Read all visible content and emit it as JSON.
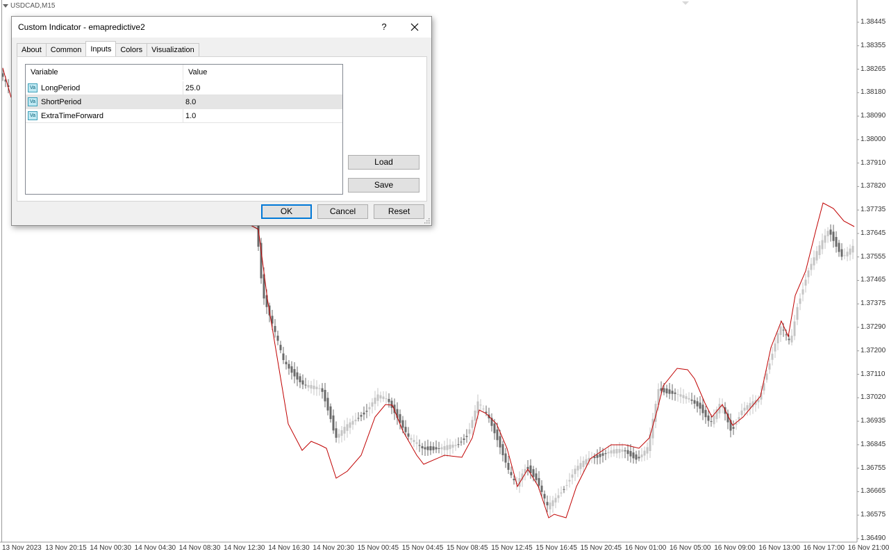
{
  "chart": {
    "symbol": "USDCAD,M15",
    "price_axis": [
      "1.38445",
      "1.38355",
      "1.38265",
      "1.38180",
      "1.38090",
      "1.38000",
      "1.37910",
      "1.37820",
      "1.37735",
      "1.37645",
      "1.37555",
      "1.37465",
      "1.37375",
      "1.37290",
      "1.37200",
      "1.37110",
      "1.37020",
      "1.36935",
      "1.36845",
      "1.36755",
      "1.36665",
      "1.36575",
      "1.36490"
    ],
    "time_axis": [
      "13 Nov 2023",
      "13 Nov 20:15",
      "14 Nov 00:30",
      "14 Nov 04:30",
      "14 Nov 08:30",
      "14 Nov 12:30",
      "14 Nov 16:30",
      "14 Nov 20:30",
      "15 Nov 00:45",
      "15 Nov 04:45",
      "15 Nov 08:45",
      "15 Nov 12:45",
      "15 Nov 16:45",
      "15 Nov 20:45",
      "16 Nov 01:00",
      "16 Nov 05:00",
      "16 Nov 09:00",
      "16 Nov 13:00",
      "16 Nov 17:00",
      "16 Nov 21:00"
    ],
    "colors": {
      "candle_up": "#c4c4c4",
      "candle_down": "#6a6a6a",
      "indicator_line": "#c00000"
    }
  },
  "dialog": {
    "title": "Custom Indicator - emapredictive2",
    "help_glyph": "?",
    "tabs": [
      {
        "label": "About"
      },
      {
        "label": "Common"
      },
      {
        "label": "Inputs"
      },
      {
        "label": "Colors"
      },
      {
        "label": "Visualization"
      }
    ],
    "active_tab": "Inputs",
    "grid": {
      "headers": {
        "variable": "Variable",
        "value": "Value"
      },
      "icon_text": "Va",
      "rows": [
        {
          "variable": "LongPeriod",
          "value": "25.0"
        },
        {
          "variable": "ShortPeriod",
          "value": "8.0"
        },
        {
          "variable": "ExtraTimeForward",
          "value": "1.0"
        }
      ],
      "selected_row": "ShortPeriod"
    },
    "buttons": {
      "load": "Load",
      "save": "Save",
      "ok": "OK",
      "cancel": "Cancel",
      "reset": "Reset"
    }
  }
}
